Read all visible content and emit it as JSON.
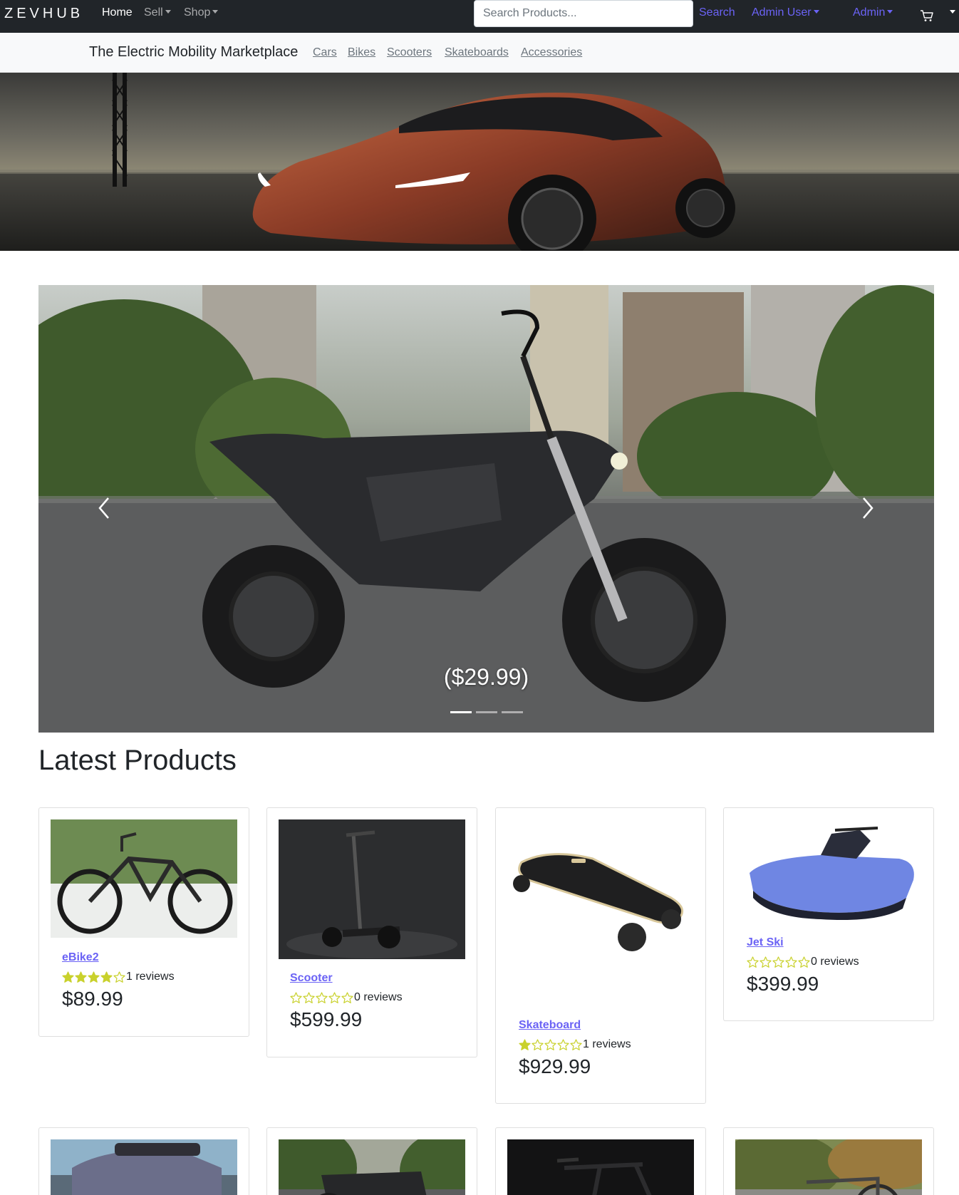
{
  "navbar": {
    "brand": "ZEVHUB",
    "home": "Home",
    "sell": "Sell",
    "shop": "Shop",
    "search_placeholder": "Search Products...",
    "search_button": "Search",
    "user_menu": "Admin User",
    "admin_menu": "Admin",
    "cart_icon": "cart-icon"
  },
  "category_bar": {
    "tagline": "The Electric Mobility Marketplace",
    "links": [
      "Cars",
      "Bikes",
      "Scooters",
      "Skateboards",
      "Accessories"
    ]
  },
  "carousel": {
    "caption": "($29.99)",
    "active_index": 0,
    "slide_count": 3,
    "prev_icon": "chevron-left-icon",
    "next_icon": "chevron-right-icon"
  },
  "latest": {
    "title": "Latest Products",
    "products": [
      {
        "name": "eBike2",
        "rating": 4,
        "reviews": "1 reviews",
        "price": "$89.99"
      },
      {
        "name": "Scooter",
        "rating": 0,
        "reviews": "0 reviews",
        "price": "$599.99"
      },
      {
        "name": "Skateboard",
        "rating": 1,
        "reviews": "1 reviews",
        "price": "$929.99"
      },
      {
        "name": "Jet Ski",
        "rating": 0,
        "reviews": "0 reviews",
        "price": "$399.99"
      }
    ]
  },
  "colors": {
    "navbar_bg": "#212529",
    "accent": "#6b63f5",
    "star": "#c9d12c"
  }
}
